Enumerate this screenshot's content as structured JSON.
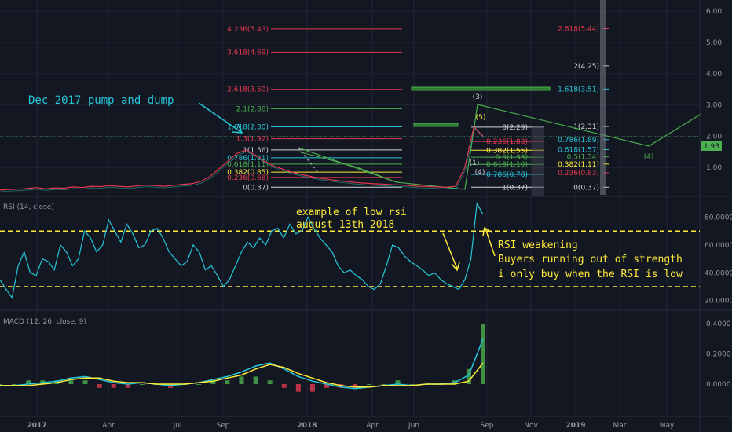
{
  "chart_data": [
    {
      "type": "line",
      "panel": "price",
      "y_axis_ticks": [
        "6.00",
        "5.00",
        "4.00",
        "3.00",
        "2.00",
        "1.00"
      ],
      "ylim": [
        0,
        6.2
      ],
      "current_price_label": "1.93",
      "current_price": 1.93,
      "annotations": [
        {
          "text": "Dec 2017 pump and dump",
          "color": "#26c6da"
        }
      ],
      "fib_left": [
        {
          "label": "4.236(5.43)",
          "value": 5.43,
          "color": "#e53950"
        },
        {
          "label": "3.618(4.69)",
          "value": 4.69,
          "color": "#e53950"
        },
        {
          "label": "2.618(3.50)",
          "value": 3.5,
          "color": "#e53950"
        },
        {
          "label": "2.1(2.88)",
          "value": 2.88,
          "color": "#4caf50"
        },
        {
          "label": "1.618(2.30)",
          "value": 2.3,
          "color": "#26c6da"
        },
        {
          "label": "1.3(1.92)",
          "value": 1.92,
          "color": "#e53950"
        },
        {
          "label": "1(1.56)",
          "value": 1.56,
          "color": "#d1d4dc"
        },
        {
          "label": "0.786(1.31)",
          "value": 1.31,
          "color": "#26c6da"
        },
        {
          "label": "0.618(1.11)",
          "value": 1.11,
          "color": "#4caf50"
        },
        {
          "label": "0.382(0.85)",
          "value": 0.85,
          "color": "#ffeb3b"
        },
        {
          "label": "0.236(0.68)",
          "value": 0.68,
          "color": "#e53950"
        },
        {
          "label": "0(0.37)",
          "value": 0.37,
          "color": "#d1d4dc"
        }
      ],
      "fib_mid": [
        {
          "label": "0(2.29)",
          "value": 2.29,
          "color": "#d1d4dc"
        },
        {
          "label": "0.236(1.83)",
          "value": 1.83,
          "color": "#e53950"
        },
        {
          "label": "0.382(1.55)",
          "value": 1.55,
          "color": "#ffeb3b"
        },
        {
          "label": "0.5(1.33)",
          "value": 1.33,
          "color": "#4caf50"
        },
        {
          "label": "0.618(1.10)",
          "value": 1.1,
          "color": "#4caf50"
        },
        {
          "label": "0.786(0.78)",
          "value": 0.78,
          "color": "#26c6da"
        },
        {
          "label": "1(0.37)",
          "value": 0.37,
          "color": "#d1d4dc"
        }
      ],
      "fib_right": [
        {
          "label": "2.618(5.44)",
          "value": 5.44,
          "color": "#e53950"
        },
        {
          "label": "2(4.25)",
          "value": 4.25,
          "color": "#d1d4dc"
        },
        {
          "label": "1.618(3.51)",
          "value": 3.51,
          "color": "#26c6da"
        },
        {
          "label": "1(2.31)",
          "value": 2.31,
          "color": "#d1d4dc"
        },
        {
          "label": "0.786(1.89)",
          "value": 1.89,
          "color": "#26c6da"
        },
        {
          "label": "0.618(1.57)",
          "value": 1.57,
          "color": "#26c6da"
        },
        {
          "label": "0.5(1.34)",
          "value": 1.34,
          "color": "#4caf50"
        },
        {
          "label": "0.382(1.11)",
          "value": 1.11,
          "color": "#ffeb3b"
        },
        {
          "label": "0.236(0.83)",
          "value": 0.83,
          "color": "#e53950"
        },
        {
          "label": "0(0.37)",
          "value": 0.37,
          "color": "#d1d4dc"
        }
      ],
      "wave_labels": [
        "(3)",
        "(5)",
        "(4)",
        "(1)",
        "(4)"
      ],
      "price_series": [
        0.28,
        0.3,
        0.31,
        0.33,
        0.36,
        0.32,
        0.35,
        0.34,
        0.38,
        0.36,
        0.4,
        0.39,
        0.42,
        0.4,
        0.38,
        0.41,
        0.44,
        0.42,
        0.4,
        0.43,
        0.46,
        0.48,
        0.55,
        0.7,
        0.95,
        1.2,
        1.45,
        1.56,
        1.4,
        1.2,
        1.05,
        0.95,
        0.85,
        0.78,
        0.72,
        0.66,
        0.62,
        0.58,
        0.55,
        0.52,
        0.5,
        0.48,
        0.47,
        0.45,
        0.44,
        0.42,
        0.4,
        0.39,
        0.38,
        0.37,
        0.4,
        1.0,
        2.3,
        2.0
      ]
    },
    {
      "type": "line",
      "panel": "rsi",
      "legend": "RSI (14, close)",
      "y_axis_ticks": [
        "80.0000",
        "60.0000",
        "40.0000",
        "20.0000"
      ],
      "ylim": [
        15,
        95
      ],
      "levels": [
        70,
        30
      ],
      "annotations": [
        {
          "text": "example of low rsi",
          "color": "#ffeb3b"
        },
        {
          "text": "august 13th 2018",
          "color": "#ffeb3b"
        },
        {
          "text": "RSI weakening",
          "color": "#ffeb3b"
        },
        {
          "text": "Buyers running out of strength",
          "color": "#ffeb3b"
        },
        {
          "text": "i only buy when the RSI is low",
          "color": "#ffeb3b"
        }
      ],
      "values": [
        35,
        28,
        22,
        45,
        55,
        40,
        38,
        50,
        48,
        42,
        60,
        55,
        45,
        50,
        70,
        65,
        55,
        60,
        78,
        70,
        62,
        75,
        68,
        58,
        60,
        70,
        72,
        65,
        55,
        50,
        45,
        48,
        60,
        55,
        42,
        45,
        38,
        30,
        35,
        45,
        55,
        62,
        58,
        65,
        60,
        70,
        72,
        65,
        75,
        68,
        70,
        80,
        72,
        65,
        60,
        55,
        45,
        40,
        42,
        38,
        35,
        30,
        28,
        32,
        45,
        60,
        58,
        52,
        48,
        45,
        42,
        38,
        40,
        35,
        32,
        30,
        28,
        35,
        50,
        90,
        82
      ]
    },
    {
      "type": "line",
      "panel": "macd",
      "legend": "MACD (12, 26, close, 9)",
      "y_axis_ticks": [
        "0.4000",
        "0.2000",
        "0.0000"
      ],
      "ylim": [
        -0.12,
        0.46
      ],
      "series": [
        {
          "values": [
            -0.01,
            -0.01,
            0.0,
            0.01,
            0.02,
            0.04,
            0.05,
            0.03,
            0.01,
            0.0,
            0.01,
            0.0,
            -0.01,
            0.0,
            0.01,
            0.03,
            0.05,
            0.08,
            0.12,
            0.14,
            0.1,
            0.05,
            0.02,
            0.0,
            -0.02,
            -0.03,
            -0.02,
            -0.01,
            0.0,
            -0.01,
            0.0,
            0.0,
            0.01,
            0.06,
            0.3
          ],
          "color": "#26c6da"
        },
        {
          "values": [
            -0.01,
            -0.01,
            -0.01,
            0.0,
            0.01,
            0.03,
            0.04,
            0.04,
            0.02,
            0.01,
            0.01,
            0.0,
            0.0,
            0.0,
            0.01,
            0.02,
            0.04,
            0.06,
            0.1,
            0.13,
            0.11,
            0.07,
            0.04,
            0.01,
            -0.01,
            -0.02,
            -0.02,
            -0.01,
            -0.01,
            -0.01,
            0.0,
            0.0,
            0.0,
            0.02,
            0.14
          ],
          "color": "#ffeb3b"
        }
      ]
    }
  ],
  "x_axis_labels": [
    "2017",
    "Apr",
    "Jul",
    "Sep",
    "2018",
    "Apr",
    "Jun",
    "Sep",
    "Nov",
    "2019",
    "Mar",
    "May"
  ],
  "colors": {
    "background": "#131722",
    "grid": "#1f2433",
    "accent_green": "#4caf50",
    "rsi_line": "#26c6da",
    "level_line": "#ffeb3b"
  }
}
